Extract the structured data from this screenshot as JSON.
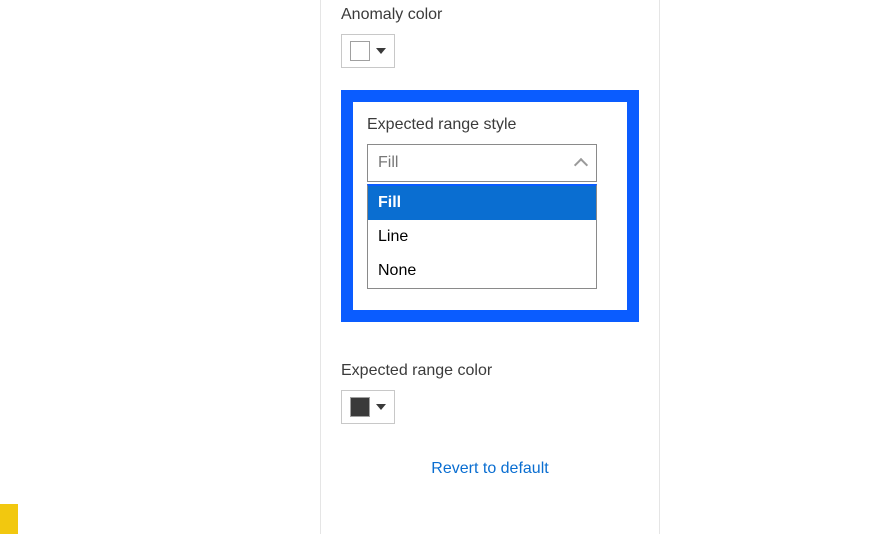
{
  "anomaly": {
    "label": "Anomaly color",
    "swatch_color": "#ffffff"
  },
  "expected_range_style": {
    "label": "Expected range style",
    "selected": "Fill",
    "options": [
      "Fill",
      "Line",
      "None"
    ]
  },
  "expected_range_color": {
    "label": "Expected range color",
    "swatch_color": "#3a3a3a"
  },
  "revert": {
    "label": "Revert to default"
  },
  "colors": {
    "highlight_border": "#0a5cff",
    "link": "#0a6ed1",
    "active_bg": "#0a6ed1"
  }
}
